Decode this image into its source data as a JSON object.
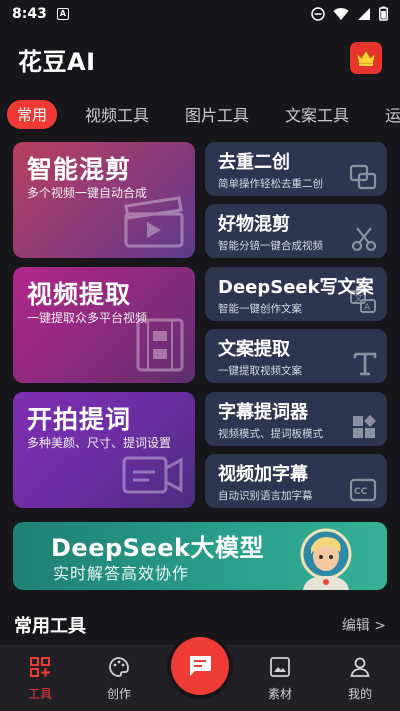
{
  "status": {
    "time": "8:43",
    "notif": "A"
  },
  "header": {
    "title": "花豆AI"
  },
  "tabs": [
    {
      "label": "常用"
    },
    {
      "label": "视频工具"
    },
    {
      "label": "图片工具"
    },
    {
      "label": "文案工具"
    },
    {
      "label": "运"
    }
  ],
  "big_cards": [
    {
      "title": "智能混剪",
      "sub": "多个视频一键自动合成"
    },
    {
      "title": "视频提取",
      "sub": "一键提取众多平台视频"
    },
    {
      "title": "开拍提词",
      "sub": "多种美颜、尺寸、提词设置"
    }
  ],
  "small_cards": [
    {
      "title": "去重二创",
      "sub": "简单操作轻松去重二创"
    },
    {
      "title": "好物混剪",
      "sub": "智能分镜一键合成视频"
    },
    {
      "title": "DeepSeek写文案",
      "sub": "智能一键创作文案"
    },
    {
      "title": "文案提取",
      "sub": "一键提取视频文案"
    },
    {
      "title": "字幕提词器",
      "sub": "视频模式、提词板模式"
    },
    {
      "title": "视频加字幕",
      "sub": "自动识别语言加字幕"
    }
  ],
  "banner": {
    "title": "DeepSeek大模型",
    "sub": "实时解答高效协作"
  },
  "section": {
    "title": "常用工具",
    "edit": "编辑 >"
  },
  "nav": [
    {
      "label": "工具"
    },
    {
      "label": "创作"
    },
    {
      "label": "素材"
    },
    {
      "label": "我的"
    }
  ],
  "colors": {
    "accent": "#ee3a35",
    "card_dark": "#2d3651",
    "banner": "#2aa08c"
  }
}
